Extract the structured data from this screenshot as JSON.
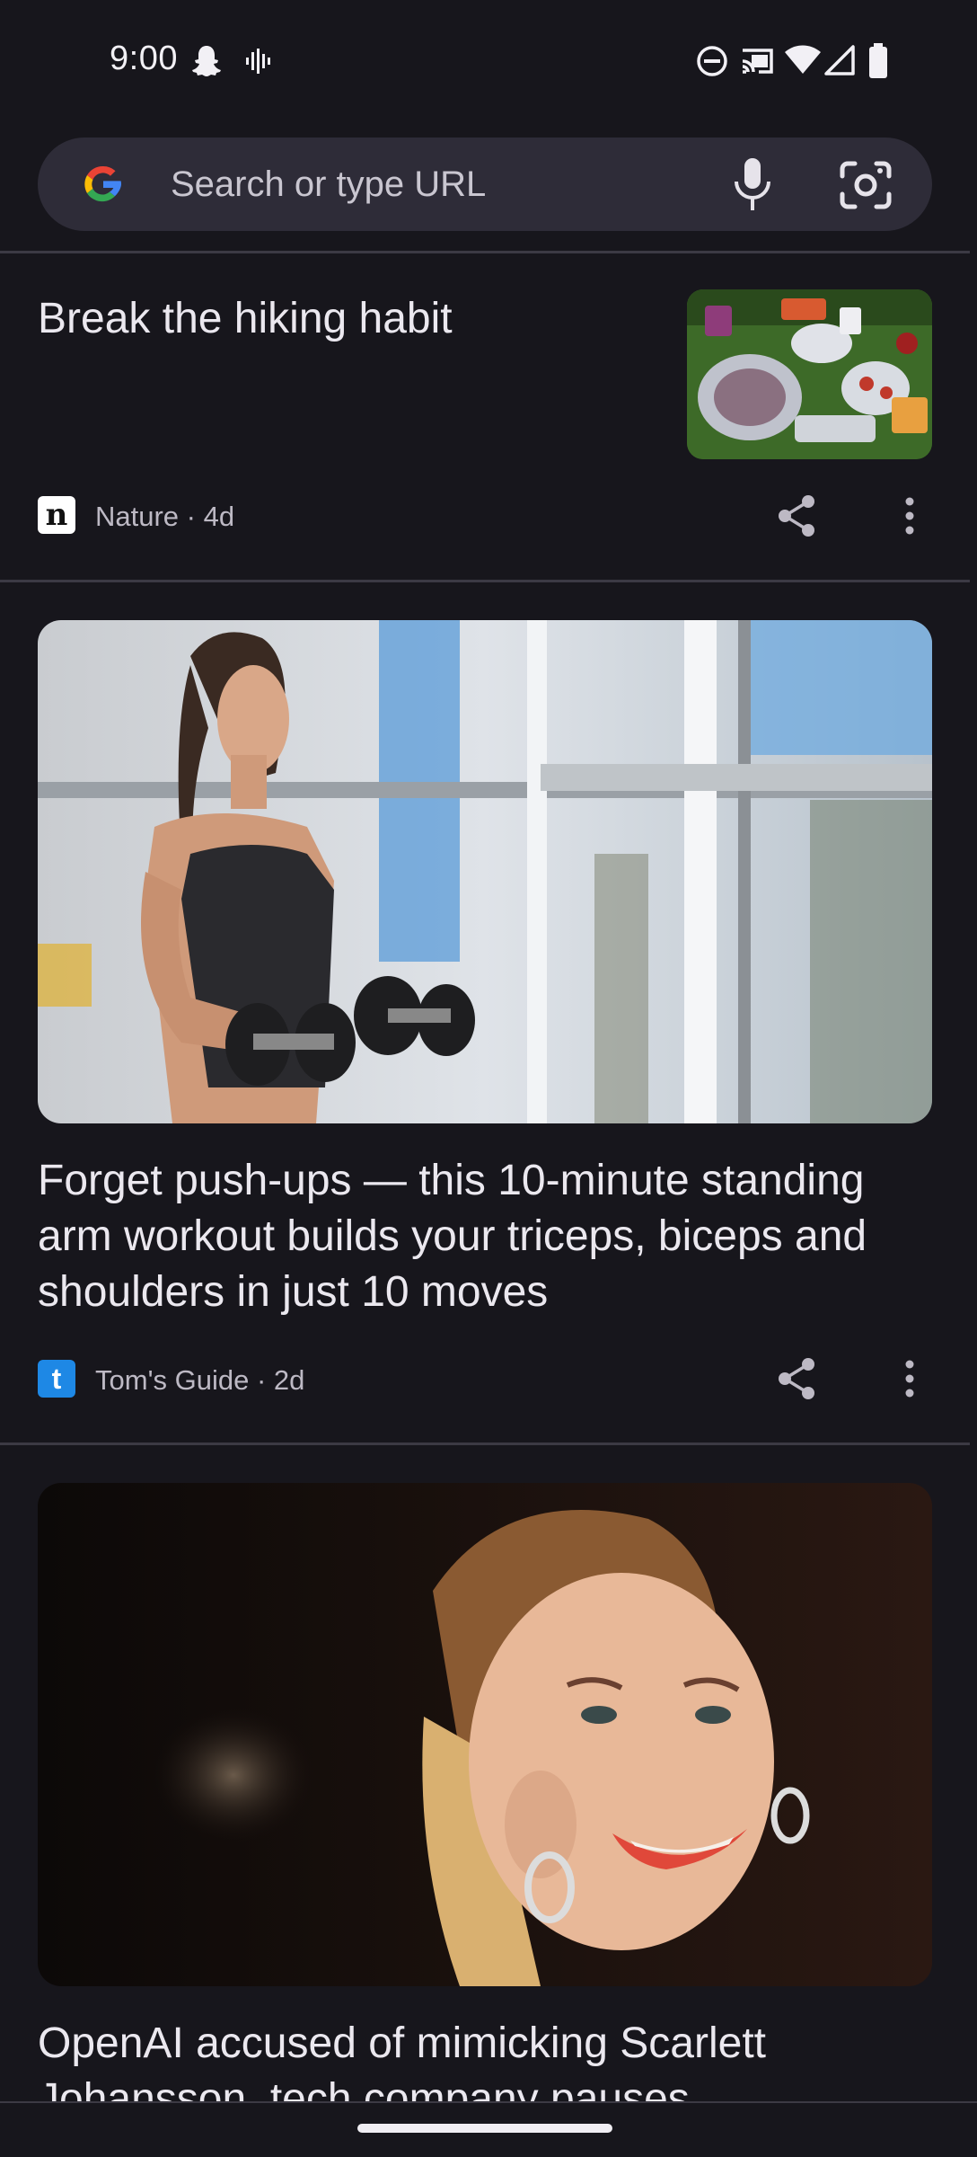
{
  "status_bar": {
    "time": "9:00"
  },
  "search": {
    "placeholder": "Search or type URL"
  },
  "feed": [
    {
      "headline": "Break the hiking habit",
      "source": "Nature",
      "age": "4d",
      "logo_letter": "n",
      "thumbnail": "picnic-food-image"
    },
    {
      "headline": "Forget push-ups — this 10-minute standing arm workout builds your triceps, biceps and shoulders in just 10 moves",
      "source": "Tom's Guide",
      "age": "2d",
      "logo_letter": "t",
      "thumbnail": "woman-dumbbell-workout-image"
    },
    {
      "headline": "OpenAI accused of mimicking Scarlett Johansson, tech company pauses",
      "thumbnail": "woman-portrait-earrings-image"
    }
  ],
  "colors": {
    "background": "#17161c",
    "search_bar": "#2e2c38",
    "text": "#ebe8ef",
    "meta_text": "#bdb9c4",
    "toms_guide_brand": "#1e88e5"
  }
}
